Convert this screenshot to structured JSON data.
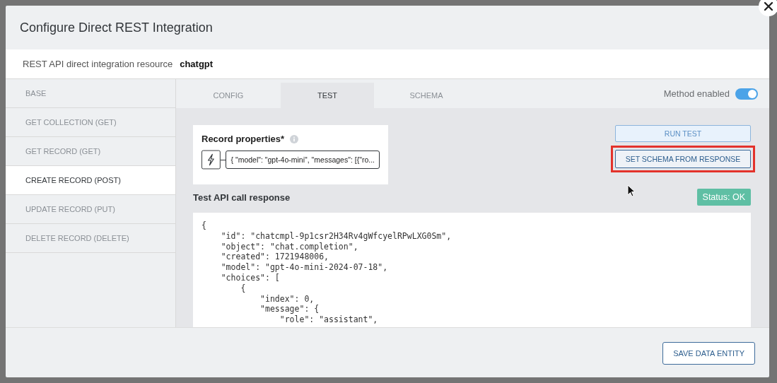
{
  "dialog": {
    "title": "Configure Direct REST Integration",
    "resource_label": "REST API direct integration resource",
    "resource_name": "chatgpt"
  },
  "sidebar": {
    "items": [
      {
        "label": "BASE",
        "selected": false
      },
      {
        "label": "GET COLLECTION (GET)",
        "selected": false
      },
      {
        "label": "GET RECORD (GET)",
        "selected": false
      },
      {
        "label": "CREATE RECORD (POST)",
        "selected": true
      },
      {
        "label": "UPDATE RECORD (PUT)",
        "selected": false
      },
      {
        "label": "DELETE RECORD (DELETE)",
        "selected": false
      }
    ]
  },
  "tabs": [
    {
      "label": "CONFIG",
      "selected": false
    },
    {
      "label": "TEST",
      "selected": true
    },
    {
      "label": "SCHEMA",
      "selected": false
    }
  ],
  "method_toggle": {
    "label": "Method enabled",
    "on": true
  },
  "record_properties": {
    "label": "Record properties*",
    "value": "{ \"model\": \"gpt-4o-mini\", \"messages\": [{\"ro..."
  },
  "run_test_button": {
    "label": "RUN TEST"
  },
  "set_schema_button": {
    "label": "SET SCHEMA FROM RESPONSE",
    "highlighted": true
  },
  "response": {
    "label": "Test API call response",
    "status": "Status: OK",
    "lines": [
      "{",
      "    \"id\": \"chatcmpl-9p1csr2H34Rv4gWfcyelRPwLXG0Sm\",",
      "    \"object\": \"chat.completion\",",
      "    \"created\": 1721948006,",
      "    \"model\": \"gpt-4o-mini-2024-07-18\",",
      "    \"choices\": [",
      "        {",
      "            \"index\": 0,",
      "            \"message\": {",
      "                \"role\": \"assistant\","
    ]
  },
  "footer": {
    "save_button": "SAVE DATA ENTITY"
  }
}
